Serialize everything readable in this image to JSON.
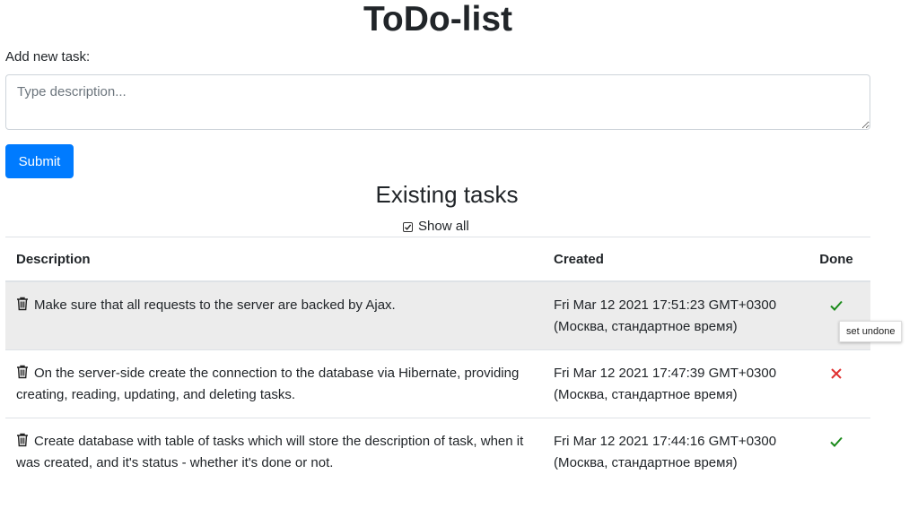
{
  "header": {
    "title": "ToDo-list",
    "add_label": "Add new task:",
    "description_placeholder": "Type description...",
    "submit_label": "Submit"
  },
  "tasks_section": {
    "title": "Existing tasks",
    "show_all_label": "Show all",
    "show_all_checked": true,
    "columns": [
      "Description",
      "Created",
      "Done"
    ],
    "rows": [
      {
        "description": "Make sure that all requests to the server are backed by Ajax.",
        "created": "Fri Mar 12 2021 17:51:23 GMT+0300 (Москва, стандартное время)",
        "done": true,
        "done_icon": "check-icon"
      },
      {
        "description": "On the server-side create the connection to the database via Hibernate, providing creating, reading, updating, and deleting tasks.",
        "created": "Fri Mar 12 2021 17:47:39 GMT+0300 (Москва, стандартное время)",
        "done": false,
        "done_icon": "cross-icon"
      },
      {
        "description": "Create database with table of tasks which will store the description of task, when it was created, and it's status - whether it's done or not.",
        "created": "Fri Mar 12 2021 17:44:16 GMT+0300 (Москва, стандартное время)",
        "done": true,
        "done_icon": "check-icon"
      }
    ]
  },
  "tooltip": {
    "text": "set undone"
  },
  "colors": {
    "primary": "#007bff",
    "done_green": "#1a8a1a",
    "undone_red": "#e03030",
    "row_highlight": "#ececec"
  }
}
